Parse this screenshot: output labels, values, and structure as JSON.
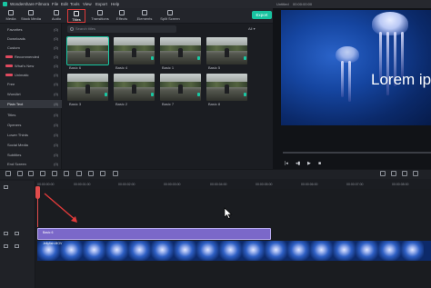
{
  "app": {
    "title": "Wondershare Filmora",
    "menu": [
      "File",
      "Edit",
      "Tools",
      "View",
      "Export",
      "Help"
    ]
  },
  "project": {
    "name": "Untitled",
    "time": "00:00:00:00"
  },
  "toolbar": {
    "tabs": [
      "Media",
      "Stock Media",
      "Audio",
      "Titles",
      "Transitions",
      "Effects",
      "Elements",
      "Split Screen"
    ],
    "active_tab": "Titles",
    "export_label": "Export"
  },
  "sidebar": {
    "items": [
      {
        "label": "Favorites",
        "count": "(0)"
      },
      {
        "label": "Downloads",
        "count": "(0)"
      },
      {
        "label": "Custom",
        "count": "(0)"
      },
      {
        "label": "Recommended",
        "count": "(0)",
        "badge": true
      },
      {
        "label": "What's New",
        "count": "(0)",
        "badge": true
      },
      {
        "label": "Unimatic",
        "count": "(0)",
        "badge": true
      },
      {
        "label": "Free",
        "count": "(0)"
      },
      {
        "label": "WordArt",
        "count": "(0)"
      },
      {
        "label": "Plain Text",
        "count": "(8)",
        "active": true
      },
      {
        "label": "Titles",
        "count": "(0)"
      },
      {
        "label": "Openers",
        "count": "(0)"
      },
      {
        "label": "Lower Thirds",
        "count": "(0)"
      },
      {
        "label": "Social Media",
        "count": "(0)"
      },
      {
        "label": "Subtitles",
        "count": "(0)"
      },
      {
        "label": "End Screen",
        "count": "(0)"
      }
    ]
  },
  "search": {
    "placeholder": "Search titles",
    "filter": "All"
  },
  "thumbnails": [
    "Basic 6",
    "Basic 4",
    "Basic 1",
    "Basic 5",
    "Basic 3",
    "Basic 2",
    "Basic 7",
    "Basic 8"
  ],
  "preview": {
    "overlay_text": "Lorem ip"
  },
  "timeline": {
    "ruler": [
      "00:00:00:00",
      "00:00:01:00",
      "00:00:02:00",
      "00:00:03:00",
      "00:00:04:00",
      "00:00:05:00",
      "00:00:06:00",
      "00:00:07:00",
      "00:00:08:00",
      "00:00:09:00"
    ],
    "title_clip": "Basic 6",
    "video_clip": "Jellyfish.MOV"
  },
  "colors": {
    "accent": "#18c3a0",
    "title_clip": "#7b68c9",
    "playhead": "#e14c4c",
    "annotation": "#e03a3a"
  }
}
